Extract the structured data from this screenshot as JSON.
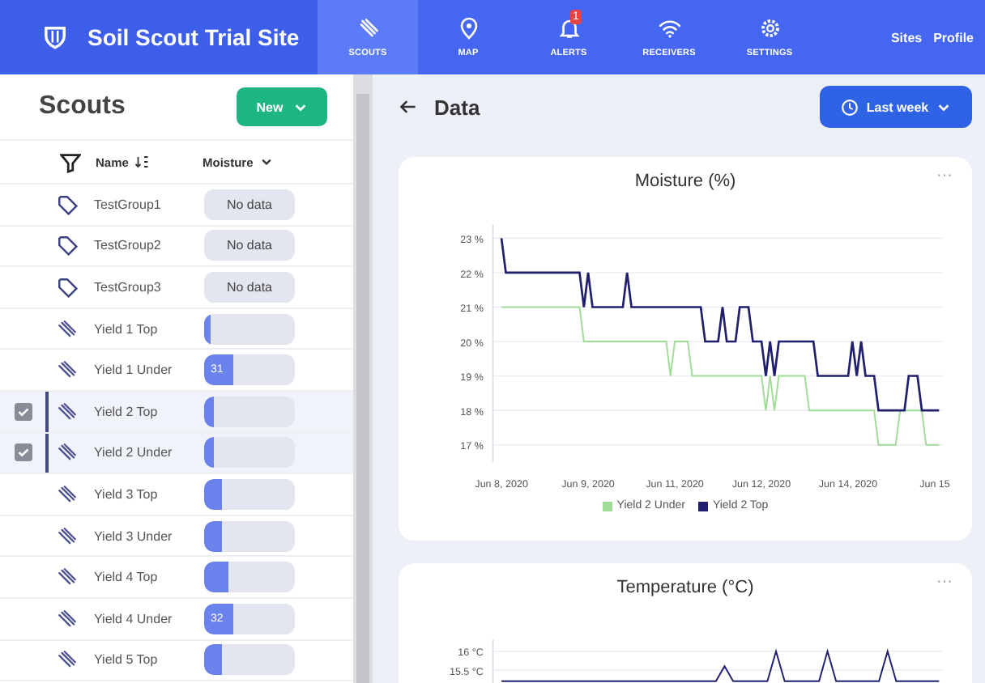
{
  "nav": {
    "title": "Soil Scout Trial Site",
    "items": [
      {
        "label": "SCOUTS",
        "selected": true
      },
      {
        "label": "MAP",
        "selected": false
      },
      {
        "label": "ALERTS",
        "selected": false,
        "badge": "1"
      },
      {
        "label": "RECEIVERS",
        "selected": false
      },
      {
        "label": "SETTINGS",
        "selected": false
      }
    ],
    "links": [
      "Sites",
      "Profile"
    ]
  },
  "sidebar": {
    "title": "Scouts",
    "new_button": "New",
    "columns": [
      "Name",
      "Moisture"
    ],
    "rows": [
      {
        "kind": "group",
        "name": "TestGroup1",
        "selected": false,
        "moisture": "No data"
      },
      {
        "kind": "group",
        "name": "TestGroup2",
        "selected": false,
        "moisture": "No data"
      },
      {
        "kind": "group",
        "name": "TestGroup3",
        "selected": false,
        "moisture": "No data"
      },
      {
        "kind": "scout",
        "name": "Yield 1 Top",
        "selected": false,
        "level": 0.08
      },
      {
        "kind": "scout",
        "name": "Yield 1 Under",
        "selected": false,
        "level": 0.33,
        "reading": "31"
      },
      {
        "kind": "scout",
        "name": "Yield 2 Top",
        "selected": true,
        "level": 0.1
      },
      {
        "kind": "scout",
        "name": "Yield 2 Under",
        "selected": true,
        "level": 0.1
      },
      {
        "kind": "scout",
        "name": "Yield 3 Top",
        "selected": false,
        "level": 0.2
      },
      {
        "kind": "scout",
        "name": "Yield 3 Under",
        "selected": false,
        "level": 0.2
      },
      {
        "kind": "scout",
        "name": "Yield 4 Top",
        "selected": false,
        "level": 0.26
      },
      {
        "kind": "scout",
        "name": "Yield 4 Under",
        "selected": false,
        "level": 0.33,
        "reading": "32"
      },
      {
        "kind": "scout",
        "name": "Yield 5 Top",
        "selected": false,
        "level": 0.2
      }
    ]
  },
  "main": {
    "title": "Data",
    "range_button": "Last week",
    "charts": [
      {
        "menu": "···",
        "chart_data": {
          "type": "line",
          "title": "Moisture (%)",
          "grid": true,
          "legend": "bottom",
          "categories": [
            "Jun 8, 2020",
            null,
            null,
            null,
            null,
            null,
            null,
            null,
            null,
            null,
            null,
            null,
            null,
            null,
            null,
            null,
            null,
            null,
            null,
            null,
            "Jun 9, 2020",
            null,
            null,
            null,
            null,
            null,
            null,
            null,
            null,
            null,
            null,
            null,
            null,
            null,
            null,
            null,
            null,
            null,
            null,
            null,
            "Jun 11, 2020",
            null,
            null,
            null,
            null,
            null,
            null,
            null,
            null,
            null,
            null,
            null,
            null,
            null,
            null,
            null,
            null,
            null,
            null,
            null,
            "Jun 12, 2020",
            null,
            null,
            null,
            null,
            null,
            null,
            null,
            null,
            null,
            null,
            null,
            null,
            null,
            null,
            null,
            null,
            null,
            null,
            null,
            "Jun 14, 2020",
            null,
            null,
            null,
            null,
            null,
            null,
            null,
            null,
            null,
            null,
            null,
            null,
            null,
            null,
            null,
            null,
            null,
            null,
            null,
            "Jun 15",
            null
          ],
          "series": [
            {
              "name": "Yield 2 Under",
              "color": "#9fdc95",
              "values": [
                21,
                21,
                21,
                21,
                21,
                21,
                21,
                21,
                21,
                21,
                21,
                21,
                21,
                21,
                21,
                21,
                21,
                21,
                21,
                20,
                20,
                20,
                20,
                20,
                20,
                20,
                20,
                20,
                20,
                20,
                20,
                20,
                20,
                20,
                20,
                20,
                20,
                20,
                20,
                19,
                20,
                20,
                20,
                20,
                19,
                19,
                19,
                19,
                19,
                19,
                19,
                19,
                19,
                19,
                19,
                19,
                19,
                19,
                19,
                19,
                19,
                18,
                19,
                18,
                19,
                19,
                19,
                19,
                19,
                19,
                19,
                18,
                18,
                18,
                18,
                18,
                18,
                18,
                18,
                18,
                18,
                18,
                18,
                18,
                18,
                18,
                18,
                17,
                17,
                17,
                17,
                17,
                18,
                18,
                18,
                18,
                18,
                18,
                17,
                17,
                17,
                17
              ]
            },
            {
              "name": "Yield 2 Top",
              "color": "#1f1f6e",
              "values": [
                23,
                22,
                22,
                22,
                22,
                22,
                22,
                22,
                22,
                22,
                22,
                22,
                22,
                22,
                22,
                22,
                22,
                22,
                22,
                21,
                22,
                21,
                21,
                21,
                21,
                21,
                21,
                21,
                21,
                22,
                21,
                21,
                21,
                21,
                21,
                21,
                21,
                21,
                21,
                21,
                21,
                21,
                21,
                21,
                21,
                21,
                21,
                20,
                20,
                20,
                20,
                21,
                20,
                20,
                20,
                21,
                21,
                21,
                20,
                20,
                20,
                19,
                20,
                19,
                20,
                20,
                20,
                20,
                20,
                20,
                20,
                20,
                20,
                19,
                19,
                19,
                19,
                19,
                19,
                19,
                19,
                20,
                19,
                20,
                19,
                19,
                19,
                18,
                18,
                18,
                18,
                18,
                18,
                18,
                19,
                19,
                19,
                18,
                18,
                18,
                18,
                18
              ]
            }
          ],
          "ylim": [
            16.5,
            23.4
          ],
          "yticks": [
            {
              "value": 17,
              "label": "17 %"
            },
            {
              "value": 18,
              "label": "18 %"
            },
            {
              "value": 19,
              "label": "19 %"
            },
            {
              "value": 20,
              "label": "20 %"
            },
            {
              "value": 21,
              "label": "21 %"
            },
            {
              "value": 22,
              "label": "22 %"
            },
            {
              "value": 23,
              "label": "23 %"
            }
          ]
        }
      },
      {
        "menu": "···",
        "chart_data": {
          "type": "line",
          "title": "Temperature (°C)",
          "grid": true,
          "categories": [
            null,
            null,
            null,
            null,
            null,
            null,
            null,
            null,
            null,
            null,
            null,
            null,
            null,
            null,
            null,
            null,
            null,
            null,
            null,
            null,
            null,
            null,
            null,
            null,
            null,
            null,
            null,
            null,
            null,
            null,
            null,
            null,
            null,
            null,
            null,
            null,
            null,
            null,
            null,
            null,
            null,
            null,
            null,
            null,
            null,
            null,
            null,
            null,
            null,
            null,
            null,
            null
          ],
          "series": [
            {
              "color": "#1f1f6e",
              "values": [
                15.2,
                15.2,
                15.2,
                15.2,
                15.2,
                15.2,
                15.2,
                15.2,
                15.2,
                15.2,
                15.2,
                15.2,
                15.2,
                15.2,
                15.2,
                15.2,
                15.2,
                15.2,
                15.2,
                15.2,
                15.2,
                15.2,
                15.2,
                15.2,
                15.2,
                15.2,
                15.6,
                15.2,
                15.2,
                15.2,
                15.2,
                15.2,
                16,
                15.2,
                15.2,
                15.2,
                15.2,
                15.2,
                16,
                15.2,
                15.2,
                15.2,
                15.2,
                15.2,
                15.2,
                16,
                15.2,
                15.2,
                15.2,
                15.2,
                15.2,
                15.2
              ]
            }
          ],
          "ylim": [
            15.1,
            16.3
          ],
          "yticks": [
            {
              "value": 16,
              "label": "16 °C"
            },
            {
              "value": 15.5,
              "label": "15.5 °C"
            }
          ]
        }
      }
    ]
  }
}
